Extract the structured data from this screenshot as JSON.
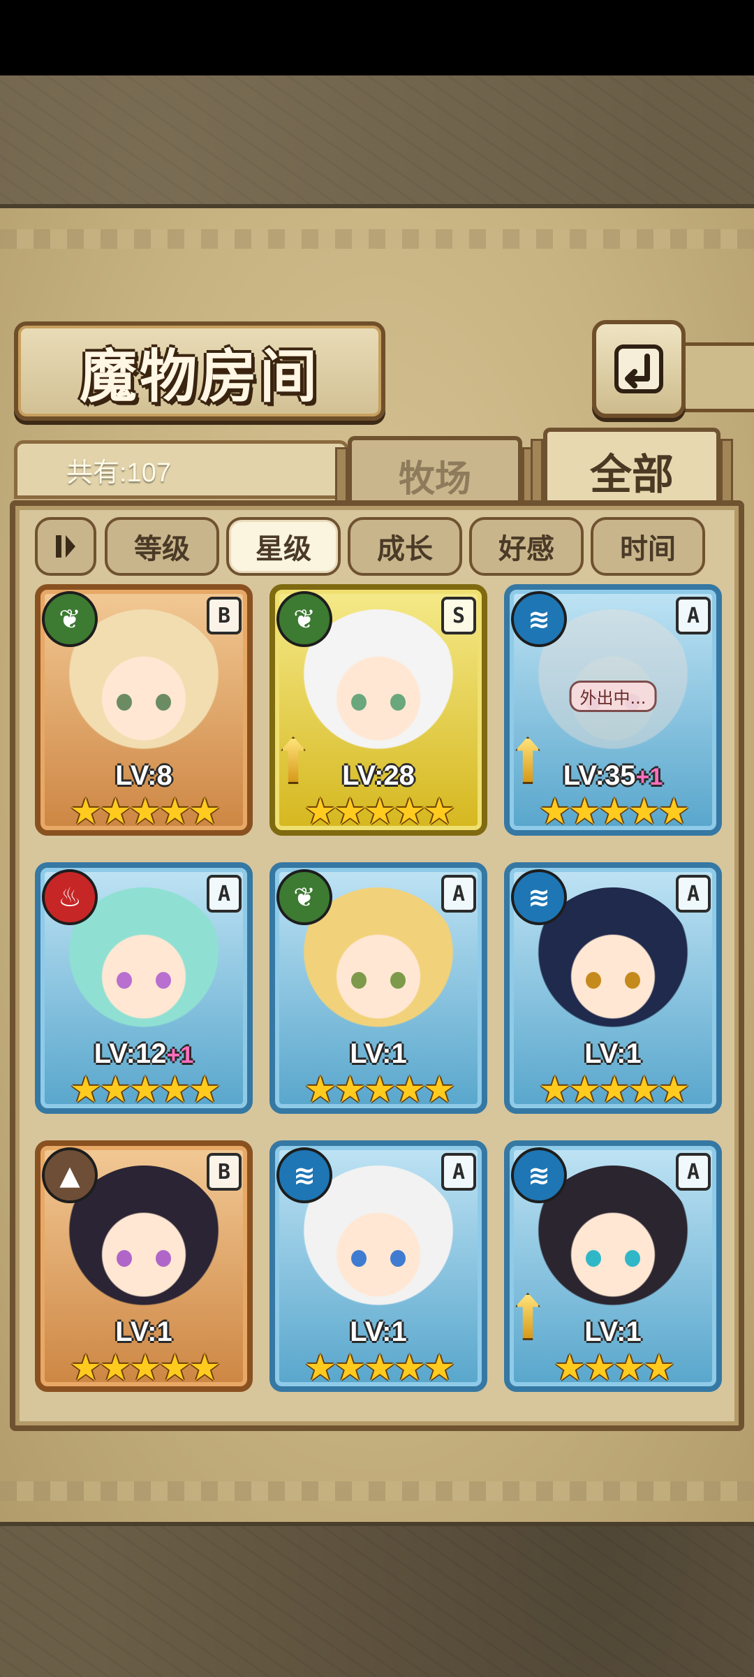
{
  "screen": {
    "title": "魔物房间",
    "total_label": "共有:107",
    "tabs": [
      {
        "label": "牧场",
        "active": false
      },
      {
        "label": "全部",
        "active": true
      }
    ],
    "sort_buttons": [
      {
        "label": "等级",
        "active": false
      },
      {
        "label": "星级",
        "active": true
      },
      {
        "label": "成长",
        "active": false
      },
      {
        "label": "好感",
        "active": false
      },
      {
        "label": "时间",
        "active": false
      }
    ],
    "back_icon": "back-arrow-icon",
    "sort_toggle_icon": "sort-order-icon"
  },
  "colors": {
    "rank_A": "#3578a3",
    "rank_B": "#8a5120",
    "rank_S": "#7f6a10",
    "element_grass": "#3d7a32",
    "element_water": "#1e76b4",
    "element_fire": "#c72626",
    "element_earth": "#6e4e37",
    "stars": "#ffcb1f"
  },
  "monsters": [
    {
      "element": "grass",
      "element_icon": "leaf-icon",
      "rank": "B",
      "level": "LV:8",
      "bonus": "",
      "stars": "★★★★★",
      "weapon": false,
      "status": ""
    },
    {
      "element": "grass",
      "element_icon": "leaf-icon",
      "rank": "S",
      "level": "LV:28",
      "bonus": "",
      "stars": "★★★★★",
      "weapon": true,
      "status": ""
    },
    {
      "element": "water",
      "element_icon": "water-waves-icon",
      "rank": "A",
      "level": "LV:35",
      "bonus": "+1",
      "stars": "★★★★★",
      "weapon": true,
      "status": "外出中..."
    },
    {
      "element": "fire",
      "element_icon": "flame-icon",
      "rank": "A",
      "level": "LV:12",
      "bonus": "+1",
      "stars": "★★★★★",
      "weapon": false,
      "status": ""
    },
    {
      "element": "grass",
      "element_icon": "leaf-icon",
      "rank": "A",
      "level": "LV:1",
      "bonus": "",
      "stars": "★★★★★",
      "weapon": false,
      "status": ""
    },
    {
      "element": "water",
      "element_icon": "water-waves-icon",
      "rank": "A",
      "level": "LV:1",
      "bonus": "",
      "stars": "★★★★★",
      "weapon": false,
      "status": ""
    },
    {
      "element": "earth",
      "element_icon": "mountain-icon",
      "rank": "B",
      "level": "LV:1",
      "bonus": "",
      "stars": "★★★★★",
      "weapon": false,
      "status": ""
    },
    {
      "element": "water",
      "element_icon": "water-waves-icon",
      "rank": "A",
      "level": "LV:1",
      "bonus": "",
      "stars": "★★★★★",
      "weapon": false,
      "status": ""
    },
    {
      "element": "water",
      "element_icon": "water-waves-icon",
      "rank": "A",
      "level": "LV:1",
      "bonus": "",
      "stars": "★★★★",
      "weapon": true,
      "status": ""
    }
  ]
}
